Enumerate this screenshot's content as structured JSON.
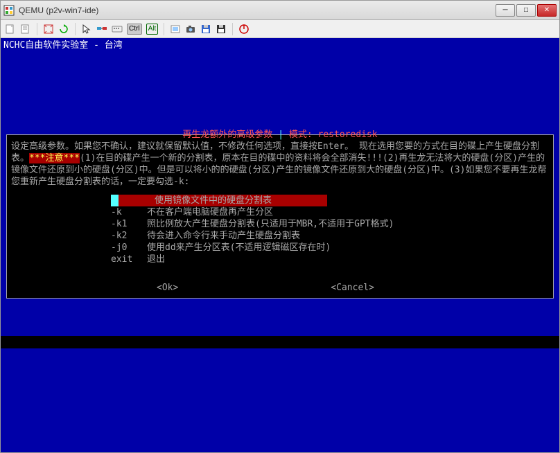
{
  "window": {
    "app_icon": "QEMU",
    "title": "QEMU (p2v-win7-ide)",
    "btn_min": "─",
    "btn_max": "□",
    "btn_close": "✕"
  },
  "toolbar": {
    "icons": [
      "file",
      "note",
      "expand",
      "refresh",
      "cursor",
      "net",
      "keybd"
    ],
    "ctrl": "Ctrl",
    "alt": "Alt",
    "icons2": [
      "snap",
      "camera",
      "floppy",
      "save",
      "power"
    ]
  },
  "terminal": {
    "banner": "NCHC自由软件实验室 - 台湾"
  },
  "dialog": {
    "title_left": "再生龙额外的高级参数",
    "title_sep": " | ",
    "title_right": "模式: restoredisk",
    "body_pre": "设定高级参数。如果您不确认，建议就保留默认值，不修改任何选项，直接按Enter。\n现在选用您要的方式在目的碟上产生硬盘分割表。",
    "body_warn": "***注意***",
    "body_post": "(1)在目的碟产生一个新的分割表，原本在目的碟中的资料将会全部消失!!!(2)再生龙无法将大的硬盘(分区)产生的镜像文件还原到小的硬盘(分区)中。但是可以将小的的硬盘(分区)产生的镜像文件还原到大的硬盘(分区)中。(3)如果您不要再生龙帮您重新产生硬盘分割表的话，一定要勾选-k:",
    "menu": [
      {
        "flag": "",
        "desc": "使用镜像文件中的硬盘分割表",
        "selected": true
      },
      {
        "flag": "-k",
        "desc": "不在客户端电脑硬盘再产生分区"
      },
      {
        "flag": "-k1",
        "desc": "照比例放大产生硬盘分割表(只适用于MBR,不适用于GPT格式)"
      },
      {
        "flag": "-k2",
        "desc": "待会进入命令行来手动产生硬盘分割表"
      },
      {
        "flag": "-j0",
        "desc": "使用dd来产生分区表(不适用逻辑磁区存在时)"
      },
      {
        "flag": "exit",
        "desc": "退出"
      }
    ],
    "ok": "<Ok>",
    "cancel": "<Cancel>"
  }
}
